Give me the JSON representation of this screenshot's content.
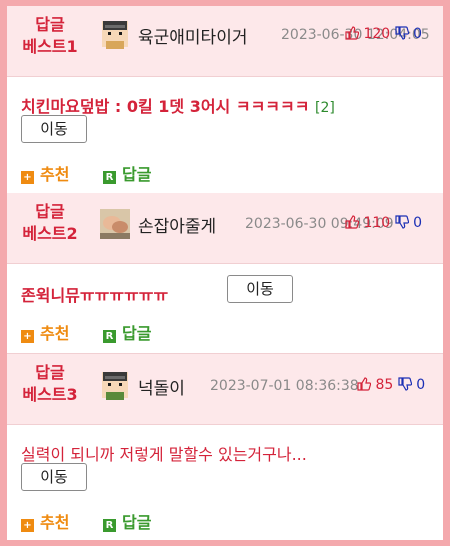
{
  "entries": [
    {
      "rank_line1": "답글",
      "rank_line2": "베스트1",
      "nickname": "육군애미타이거",
      "datetime": "2023-06-30 12:04:05",
      "up": "120",
      "down": "0",
      "content": "치킨마요덮밥 : 0킬 1뎃 3어시 ㅋㅋㅋㅋㅋ",
      "reply_count": "[2]",
      "move_label": "이동",
      "recommend_label": "추천",
      "reply_label": "답글"
    },
    {
      "rank_line1": "답글",
      "rank_line2": "베스트2",
      "nickname": "손잡아줄게",
      "datetime": "2023-06-30 09:49:09",
      "up": "110",
      "down": "0",
      "content": "존윅니뮤ㅠㅠㅠㅠㅠㅠ",
      "reply_count": "",
      "move_label": "이동",
      "recommend_label": "추천",
      "reply_label": "답글"
    },
    {
      "rank_line1": "답글",
      "rank_line2": "베스트3",
      "nickname": "넉돌이",
      "datetime": "2023-07-01 08:36:38",
      "up": "85",
      "down": "0",
      "content": "실력이 되니까 저렇게 말할수 있는거구나...",
      "reply_count": "",
      "move_label": "이동",
      "recommend_label": "추천",
      "reply_label": "답글"
    }
  ],
  "colors": {
    "border": "#f4a9ad",
    "header_bg": "#fde8ea",
    "accent_red": "#d4233a",
    "recommend_orange": "#ef8b11",
    "reply_green": "#3a9a2e",
    "down_blue": "#1b2fb5"
  },
  "icons": [
    "avatar-pixel-soldier",
    "avatar-photo",
    "thumbs-up-icon",
    "thumbs-down-icon",
    "plus-icon",
    "reply-icon"
  ]
}
